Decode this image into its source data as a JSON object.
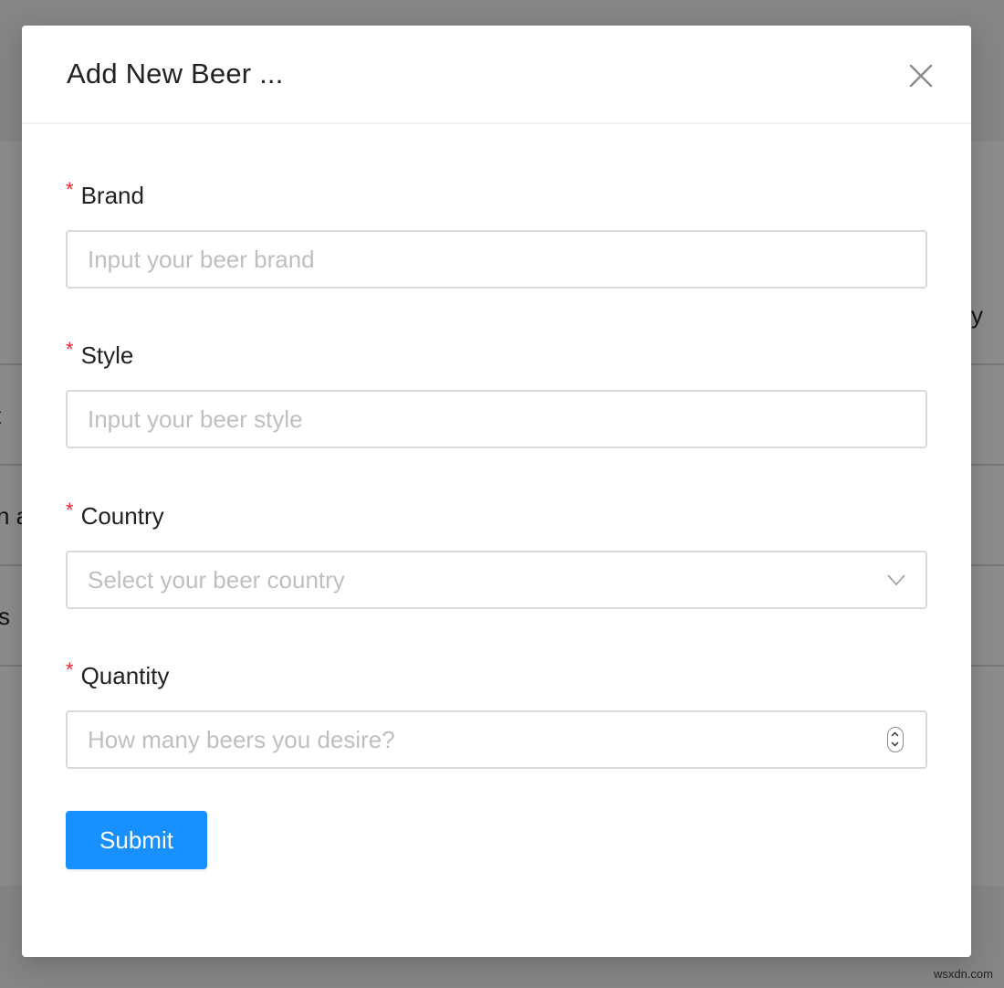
{
  "background": {
    "table_fragments": [
      {
        "text": "y"
      },
      {
        "text": "t"
      },
      {
        "text": "n a"
      },
      {
        "text": "s"
      }
    ]
  },
  "modal": {
    "title": "Add New Beer ...",
    "close_icon": "close-icon",
    "fields": [
      {
        "label": "Brand",
        "required": "*",
        "type": "text",
        "placeholder": "Input your beer brand",
        "value": ""
      },
      {
        "label": "Style",
        "required": "*",
        "type": "text",
        "placeholder": "Input your beer style",
        "value": ""
      },
      {
        "label": "Country",
        "required": "*",
        "type": "select",
        "placeholder": "Select your beer country",
        "icon": "chevron-down-icon"
      },
      {
        "label": "Quantity",
        "required": "*",
        "type": "number",
        "placeholder": "How many beers you desire?",
        "value": "",
        "icon": "stepper-icon"
      }
    ],
    "submit_label": "Submit"
  },
  "colors": {
    "primary": "#1890ff",
    "required": "#f5222d",
    "placeholder": "#bfbfbf",
    "border": "#d9d9d9"
  },
  "watermark": "wsxdn.com"
}
